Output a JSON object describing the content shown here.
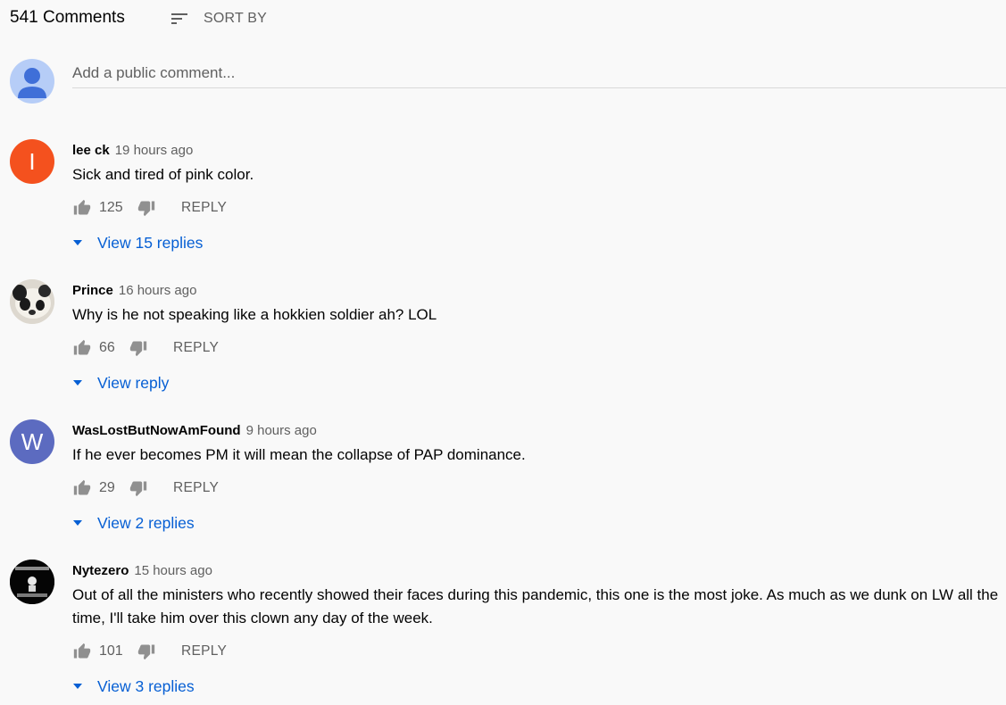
{
  "header": {
    "count_label": "541 Comments",
    "sort_label": "SORT BY",
    "sort_icon": "sort-icon"
  },
  "add_comment": {
    "placeholder": "Add a public comment...",
    "avatar_icon": "user-avatar-icon"
  },
  "comments": [
    {
      "author": "lee ck",
      "time": "19 hours ago",
      "text": "Sick and tired of pink color.",
      "likes": "125",
      "reply_label": "REPLY",
      "view_replies": "View 15 replies",
      "avatar_letter": "I",
      "avatar_color": "#f4511e"
    },
    {
      "author": "Prince",
      "time": "16 hours ago",
      "text": "Why is he not speaking like a hokkien soldier ah? LOL",
      "likes": "66",
      "reply_label": "REPLY",
      "view_replies": "View reply",
      "avatar_icon": "panda-avatar"
    },
    {
      "author": "WasLostButNowAmFound",
      "time": "9 hours ago",
      "text": "If he ever becomes PM it will mean the collapse of PAP dominance.",
      "likes": "29",
      "reply_label": "REPLY",
      "view_replies": "View 2 replies",
      "avatar_letter": "W",
      "avatar_color": "#5c6bc0"
    },
    {
      "author": "Nytezero",
      "time": "15 hours ago",
      "text": "Out of all the ministers who recently showed their faces during this pandemic, this one is the most joke. As much as we dunk on LW all the time, I'll take him over this clown any day of the week.",
      "likes": "101",
      "reply_label": "REPLY",
      "view_replies": "View 3 replies",
      "avatar_icon": "dark-meme-avatar"
    }
  ],
  "colors": {
    "background": "#f9f9f9",
    "link": "#065fd4",
    "secondary_text": "#606060",
    "primary_text": "#030303"
  }
}
